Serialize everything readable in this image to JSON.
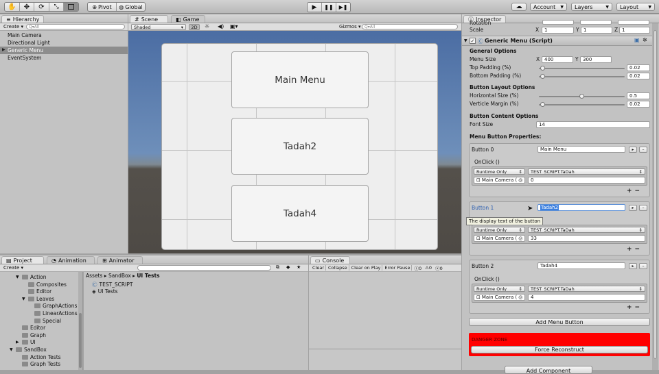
{
  "toolbar": {
    "pivot": "Pivot",
    "global": "Global",
    "account": "Account",
    "layers": "Layers",
    "layout": "Layout"
  },
  "hierarchy": {
    "tab": "Hierarchy",
    "create": "Create",
    "search_placeholder": "Q▾All",
    "items": [
      "Main Camera",
      "Directional Light",
      "Generic Menu",
      "EventSystem"
    ]
  },
  "scene": {
    "tab_scene": "Scene",
    "tab_game": "Game",
    "shaded": "Shaded",
    "mode_2d": "2D",
    "gizmos": "Gizmos",
    "search_placeholder": "Q▾All",
    "buttons": [
      "Main Menu",
      "Tadah2",
      "Tadah4"
    ]
  },
  "project": {
    "tab_project": "Project",
    "tab_animation": "Animation",
    "tab_animator": "Animator",
    "create": "Create",
    "folders": [
      {
        "label": "Action",
        "indent": 1
      },
      {
        "label": "Composites",
        "indent": 2
      },
      {
        "label": "Editor",
        "indent": 2
      },
      {
        "label": "Leaves",
        "indent": 2
      },
      {
        "label": "GraphActions",
        "indent": 3
      },
      {
        "label": "LinearActions",
        "indent": 3
      },
      {
        "label": "Special",
        "indent": 3
      },
      {
        "label": "Editor",
        "indent": 1
      },
      {
        "label": "Graph",
        "indent": 1
      },
      {
        "label": "UI",
        "indent": 1
      },
      {
        "label": "SandBox",
        "indent": 0
      },
      {
        "label": "Action Tests",
        "indent": 1
      },
      {
        "label": "Graph Tests",
        "indent": 1
      }
    ],
    "breadcrumb": [
      "Assets",
      "SandBox",
      "UI Tests"
    ],
    "assets": [
      "TEST_SCRIPT",
      "UI Tests"
    ]
  },
  "console": {
    "tab": "Console",
    "clear": "Clear",
    "collapse": "Collapse",
    "clear_on_play": "Clear on Play",
    "error_pause": "Error Pause",
    "count_info": "0",
    "count_warn": "0",
    "count_error": "0"
  },
  "inspector": {
    "tab": "Inspector",
    "rotation": "Rotation",
    "scale_label": "Scale",
    "scale": {
      "x": "1",
      "y": "1",
      "z": "1"
    },
    "component": "Generic Menu (Script)",
    "general_options": "General Options",
    "menu_size_label": "Menu Size",
    "menu_size": {
      "x": "400",
      "y": "300"
    },
    "top_padding_label": "Top Padding (%)",
    "top_padding": 0.02,
    "top_padding_text": "0.02",
    "bottom_padding_label": "Bottom Padding (%)",
    "bottom_padding": 0.02,
    "bottom_padding_text": "0.02",
    "layout_options": "Button Layout Options",
    "horizontal_size_label": "Horizontal Size (%)",
    "horizontal_size": 0.5,
    "horizontal_size_text": "0.5",
    "verticle_margin_label": "Verticle Margin (%)",
    "verticle_margin": 0.02,
    "verticle_margin_text": "0.02",
    "content_options": "Button Content Options",
    "font_size_label": "Font Size",
    "font_size": "14",
    "menu_button_properties": "Menu Button Properties:",
    "buttons": [
      {
        "label": "Button 0",
        "text": "Main Menu",
        "onclick": "OnClick ()",
        "runtime": "Runtime Only",
        "function": "TEST_SCRIPT.TaDah",
        "object": "Main Camera (",
        "arg": "0"
      },
      {
        "label": "Button 1",
        "text": "Tadah2",
        "onclick": "OnClick ()",
        "runtime": "Runtime Only",
        "function": "TEST_SCRIPT.TaDah",
        "object": "Main Camera (",
        "arg": "33"
      },
      {
        "label": "Button 2",
        "text": "Tadah4",
        "onclick": "OnClick ()",
        "runtime": "Runtime Only",
        "function": "TEST_SCRIPT.TaDah",
        "object": "Main Camera (",
        "arg": "4"
      }
    ],
    "tooltip": "The display text of the button",
    "add_menu_button": "Add Menu Button",
    "danger_zone": "DANGER ZONE",
    "force_reconstruct": "Force Reconstruct",
    "add_component": "Add Component"
  },
  "colors": {
    "scene_sky": "#4b6da3",
    "scene_ground": "#54504b",
    "danger": "#ff0000",
    "selection": "#8d8d8d",
    "text_highlight": "#3d80df"
  }
}
